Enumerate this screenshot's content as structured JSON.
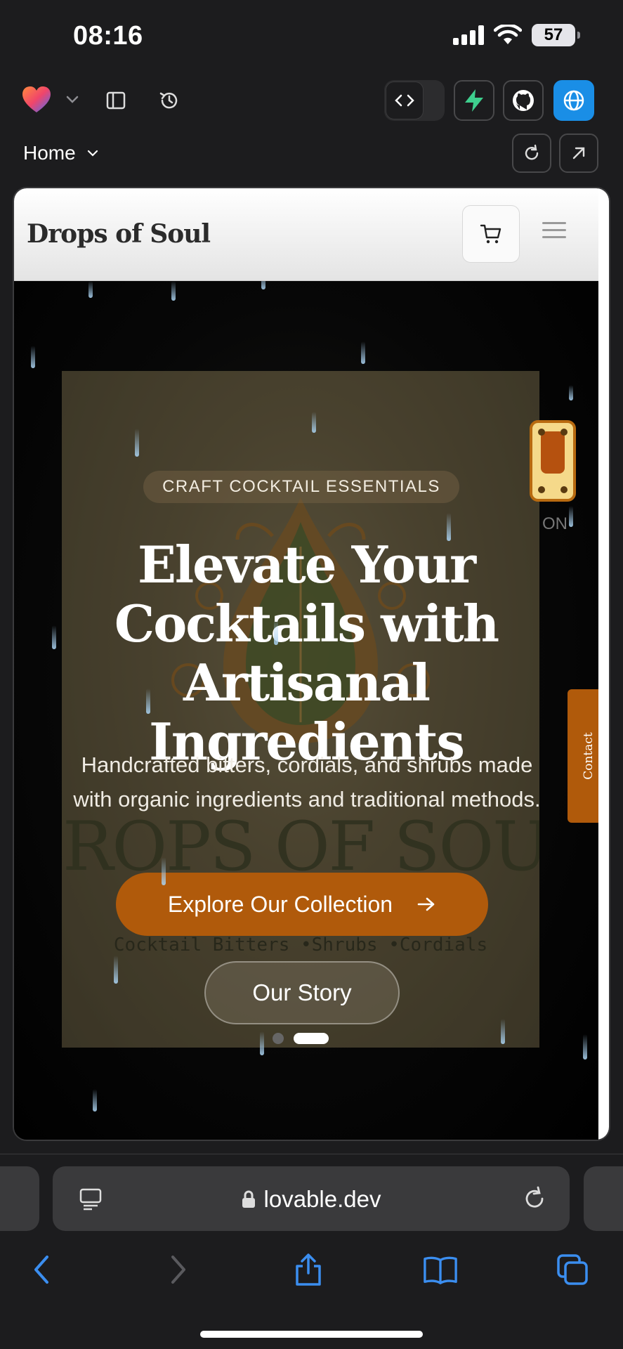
{
  "status_bar": {
    "time": "08:16",
    "battery": "57"
  },
  "editor": {
    "page_selector": "Home"
  },
  "site": {
    "brand": "Drops of Soul",
    "hero": {
      "badge": "CRAFT COCKTAIL ESSENTIALS",
      "headline_lines": [
        "Elevate Your",
        "Cocktails with",
        "Artisanal Ingredients"
      ],
      "subtext_lines": [
        "Handcrafted bitters, cordials, and shrubs made",
        "with organic ingredients and traditional methods."
      ],
      "primary_cta": "Explore Our Collection",
      "secondary_cta": "Our Story",
      "background_logo_title": "DROPS OF SOUL",
      "background_logo_tagline": "Cocktail Bitters •Shrubs •Cordials",
      "carousel": {
        "total": 2,
        "active_index": 2
      },
      "partial_text": "ON"
    },
    "contact_tab": "Contact"
  },
  "browser": {
    "url": "lovable.dev"
  },
  "colors": {
    "accent": "#b05a0b",
    "blue": "#1a8ee6",
    "nav_blue": "#3b8ef0"
  },
  "icons": [
    "heart-logo-icon",
    "chevron-down-icon",
    "sidebar-icon",
    "history-icon",
    "code-icon",
    "supabase-icon",
    "github-icon",
    "globe-icon",
    "refresh-icon",
    "external-link-icon",
    "cart-icon",
    "menu-icon",
    "lock-icon",
    "reader-icon",
    "reload-icon",
    "back-icon",
    "forward-icon",
    "share-icon",
    "bookmarks-icon",
    "tabs-icon"
  ]
}
